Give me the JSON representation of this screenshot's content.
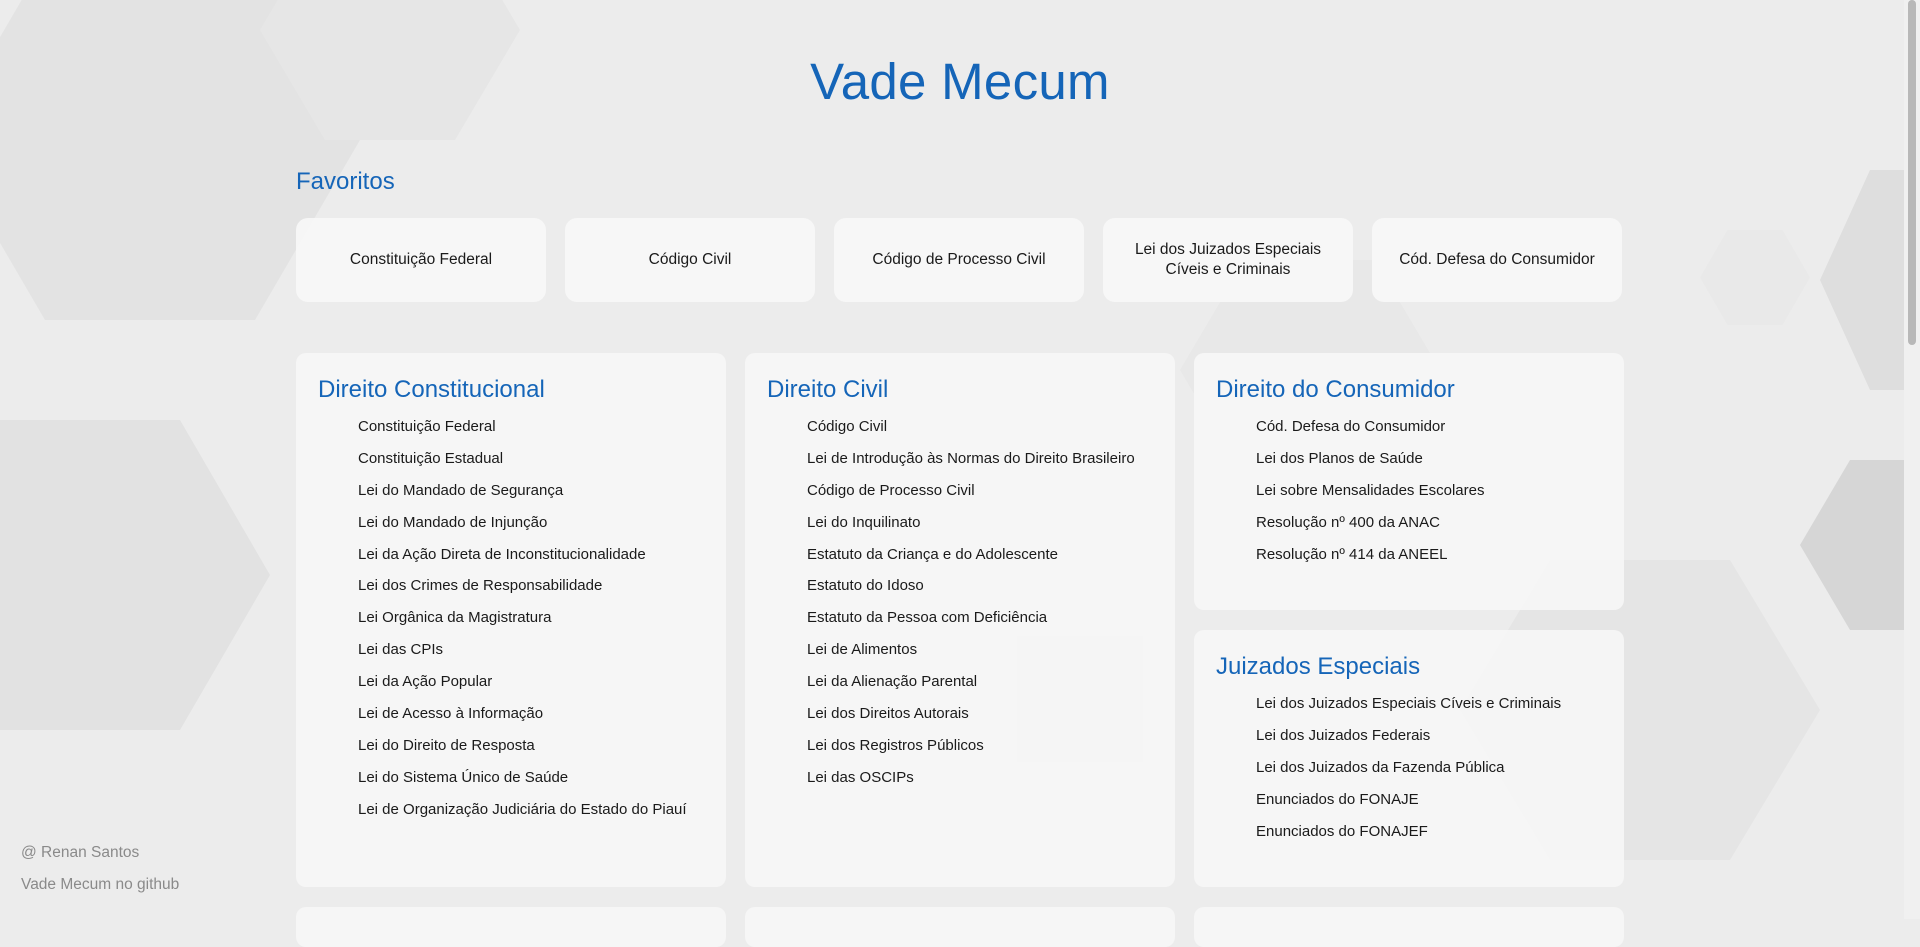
{
  "header": {
    "title": "Vade Mecum"
  },
  "favorites": {
    "title": "Favoritos",
    "items": [
      "Constituição Federal",
      "Código Civil",
      "Código de Processo Civil",
      "Lei dos Juizados Especiais Cíveis e Criminais",
      "Cód. Defesa do Consumidor"
    ]
  },
  "categories": [
    {
      "title": "Direito Constitucional",
      "items": [
        "Constituição Federal",
        "Constituição Estadual",
        "Lei do Mandado de Segurança",
        "Lei do Mandado de Injunção",
        "Lei da Ação Direta de Inconstitucionalidade",
        "Lei dos Crimes de Responsabilidade",
        "Lei Orgânica da Magistratura",
        "Lei das CPIs",
        "Lei da Ação Popular",
        "Lei de Acesso à Informação",
        "Lei do Direito de Resposta",
        "Lei do Sistema Único de Saúde",
        "Lei de Organização Judiciária do Estado do Piauí"
      ]
    },
    {
      "title": "Direito Civil",
      "items": [
        "Código Civil",
        "Lei de Introdução às Normas do Direito Brasileiro",
        "Código de Processo Civil",
        "Lei do Inquilinato",
        "Estatuto da Criança e do Adolescente",
        "Estatuto do Idoso",
        "Estatuto da Pessoa com Deficiência",
        "Lei de Alimentos",
        "Lei da Alienação Parental",
        "Lei dos Direitos Autorais",
        "Lei dos Registros Públicos",
        "Lei das OSCIPs"
      ]
    },
    {
      "title": "Direito do Consumidor",
      "items": [
        "Cód. Defesa do Consumidor",
        "Lei dos Planos de Saúde",
        "Lei sobre Mensalidades Escolares",
        "Resolução nº 400 da ANAC",
        "Resolução nº 414 da ANEEL"
      ]
    },
    {
      "title": "Juizados Especiais",
      "items": [
        "Lei dos Juizados Especiais Cíveis e Criminais",
        "Lei dos Juizados Federais",
        "Lei dos Juizados da Fazenda Pública",
        "Enunciados do FONAJE",
        "Enunciados do FONAJEF"
      ]
    }
  ],
  "footer": {
    "author": "@ Renan Santos",
    "github_link": "Vade Mecum no github"
  }
}
